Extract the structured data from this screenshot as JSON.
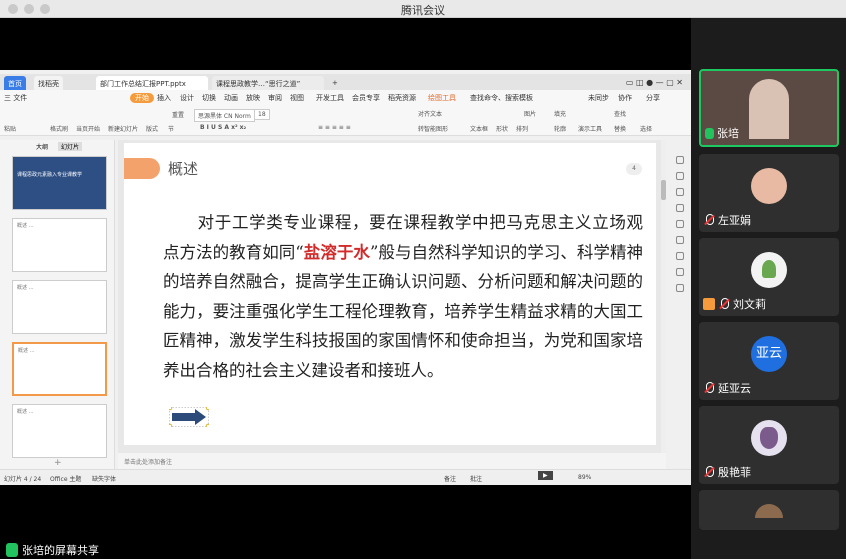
{
  "window": {
    "title": "腾讯会议"
  },
  "share_label": "张培的屏幕共享",
  "ppt": {
    "tabs": [
      {
        "label": "首页"
      },
      {
        "label": "找稻壳"
      },
      {
        "label": "部门工作总结汇报PPT.pptx"
      },
      {
        "label": "课程思政教学…“思行之道”"
      },
      {
        "label": "+"
      }
    ],
    "menu": [
      "三 文件",
      "开始",
      "插入",
      "设计",
      "切换",
      "动画",
      "放映",
      "审阅",
      "视图",
      "开发工具",
      "会员专享",
      "稻壳资源",
      "绘图工具",
      "查找命令、搜索模板",
      "未同步",
      "协作",
      "分享"
    ],
    "toolbar": {
      "paste": "粘贴",
      "format_painter": "格式刷",
      "start_from": "当页开始",
      "new_slide": "新建幻灯片",
      "layout": "版式",
      "section": "节",
      "reset": "重置",
      "font_name": "思源黑体 CN Norm",
      "font_size": "18",
      "align_text": "对齐文本",
      "convert_smartart": "转智能图形",
      "textbox": "文本框",
      "shape": "形状",
      "arrange": "排列",
      "picture": "图片",
      "fill": "填充",
      "outline": "轮廓",
      "show_tools": "演示工具",
      "find": "查找",
      "replace": "替换",
      "select": "选择"
    },
    "left_tabs": [
      "大纲",
      "幻灯片"
    ],
    "thumbs": [
      {
        "num": "1",
        "text": "课程思政元素融入专业课教学"
      },
      {
        "num": "2",
        "text": "概述 …"
      },
      {
        "num": "3",
        "text": "概述 …"
      },
      {
        "num": "4",
        "text": "概述 …"
      },
      {
        "num": "5",
        "text": "概述 …"
      }
    ],
    "slide": {
      "section_title": "概述",
      "page_number": "4",
      "text_before": "对于工学类专业课程，要在课程教学中把马克思主义立场观点方法的教育如同“",
      "highlight": "盐溶于水",
      "text_after": "”般与自然科学知识的学习、科学精神的培养自然融合，提高学生正确认识问题、分析问题和解决问题的能力，要注重强化学生工程伦理教育，培养学生精益求精的大国工匠精神，激发学生科技报国的家国情怀和使命担当，为党和国家培养出合格的社会主义建设者和接班人。"
    },
    "notes_placeholder": "单击此处添加备注",
    "status": {
      "slide_count": "幻灯片 4 / 24",
      "theme": "Office 主题",
      "font_missing": "缺失字体",
      "notes": "备注",
      "comments": "批注",
      "zoom": "89%"
    }
  },
  "participants": [
    {
      "name": "张培",
      "active": true
    },
    {
      "name": "左亚娟",
      "active": false
    },
    {
      "name": "刘文莉",
      "active": false
    },
    {
      "name": "延亚云",
      "avatar_text": "亚云",
      "active": false
    },
    {
      "name": "殷艳菲",
      "active": false
    }
  ]
}
